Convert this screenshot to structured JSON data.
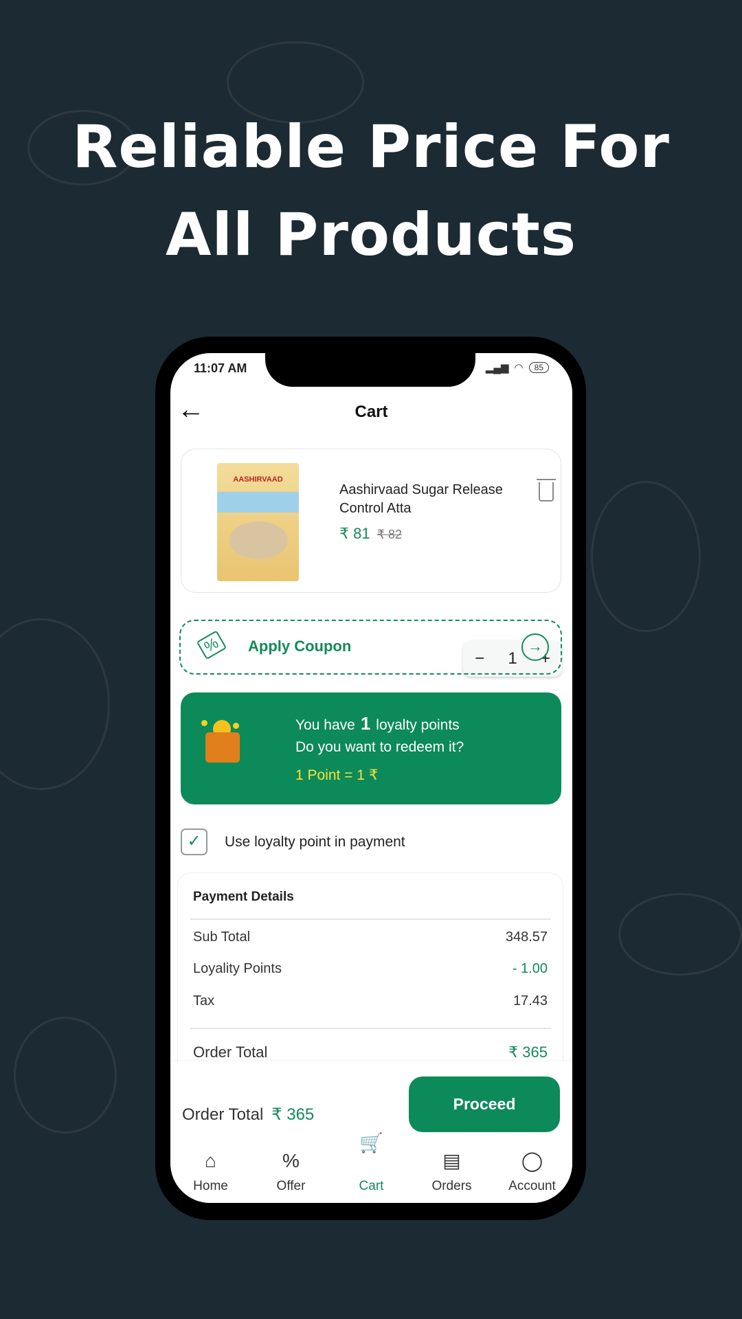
{
  "headline": {
    "line1": "Reliable Price For",
    "line2": "All Products"
  },
  "colors": {
    "background": "#1c2a33",
    "accent": "#0d8a5a",
    "highlight": "#f8e23a"
  },
  "status_bar": {
    "time": "11:07 AM",
    "battery": "85",
    "icons": [
      "signal-icon",
      "wifi-icon",
      "battery-icon"
    ]
  },
  "header": {
    "title": "Cart",
    "back_icon": "arrow-left-icon"
  },
  "cart_item": {
    "brand_on_pack": "AASHIRVAAD",
    "name": "Aashirvaad Sugar Release Control Atta",
    "price": "₹ 81",
    "mrp": "₹ 82",
    "quantity": "1",
    "minus": "−",
    "plus": "+"
  },
  "coupon": {
    "label": "Apply Coupon",
    "icon": "coupon-icon",
    "arrow": "→"
  },
  "loyalty": {
    "prefix": "You have",
    "points": "1",
    "suffix": "loyalty points",
    "question": "Do you want to redeem it?",
    "rate": "1 Point = 1 ₹"
  },
  "use_loyalty": {
    "checked": true,
    "check": "✓",
    "label": "Use loyalty point in payment"
  },
  "payment": {
    "title": "Payment Details",
    "rows": [
      {
        "label": "Sub Total",
        "value": "348.57"
      },
      {
        "label": "Loyality Points",
        "value": "- 1.00"
      },
      {
        "label": "Tax",
        "value": "17.43"
      }
    ],
    "total_label": "Order Total",
    "total_value": "₹ 365"
  },
  "footer": {
    "total_label": "Order Total",
    "total_value": "₹ 365",
    "proceed": "Proceed"
  },
  "nav": [
    {
      "label": "Home",
      "icon": "home-icon",
      "glyph": "⌂"
    },
    {
      "label": "Offer",
      "icon": "percent-icon",
      "glyph": "%"
    },
    {
      "label": "Cart",
      "icon": "cart-icon",
      "glyph": "🛒",
      "active": true
    },
    {
      "label": "Orders",
      "icon": "orders-icon",
      "glyph": "▤"
    },
    {
      "label": "Account",
      "icon": "user-icon",
      "glyph": "◯"
    }
  ]
}
